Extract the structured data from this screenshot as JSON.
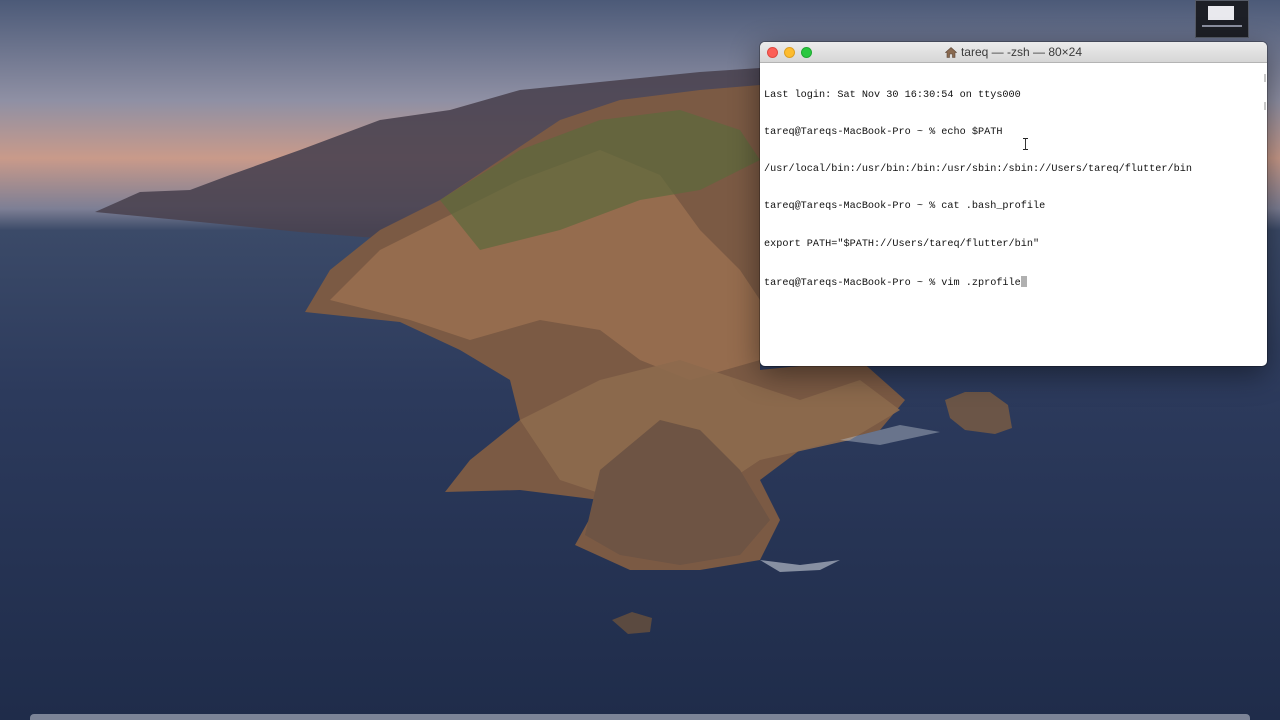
{
  "terminal": {
    "title": "tareq — -zsh — 80×24",
    "lines": [
      "Last login: Sat Nov 30 16:30:54 on ttys000",
      "tareq@Tareqs-MacBook-Pro ~ % echo $PATH",
      "/usr/local/bin:/usr/bin:/bin:/usr/sbin:/sbin://Users/tareq/flutter/bin",
      "tareq@Tareqs-MacBook-Pro ~ % cat .bash_profile",
      "export PATH=\"$PATH://Users/tareq/flutter/bin\"",
      "tareq@Tareqs-MacBook-Pro ~ % vim .zprofile"
    ],
    "title_icon": "home-icon",
    "traffic_lights": {
      "close": "#fc5f57",
      "minimize": "#fdbc2e",
      "maximize": "#29c840"
    }
  },
  "desktop": {
    "wallpaper": "macOS Catalina island"
  }
}
